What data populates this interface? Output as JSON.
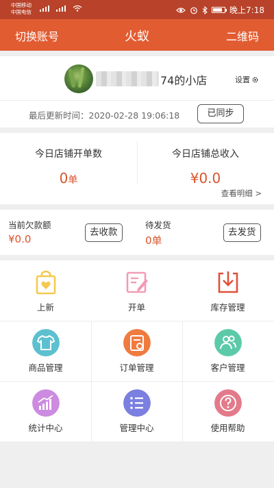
{
  "status_bar": {
    "carrier1": "中国移动",
    "carrier2": "中国电信",
    "time": "晚上7:18",
    "icons": [
      "eye-icon",
      "alarm-icon",
      "bluetooth-icon",
      "battery-icon"
    ]
  },
  "nav": {
    "left": "切换账号",
    "title": "火蚁",
    "right": "二维码"
  },
  "profile": {
    "shop_name": "74的小店",
    "settings": "设置",
    "update_time": "最后更新时间：2020-02-28 19:06:18",
    "sync_button": "已同步"
  },
  "stats": {
    "orders_label": "今日店铺开单数",
    "orders_value": "0",
    "orders_unit": "单",
    "revenue_label": "今日店铺总收入",
    "revenue_value": "¥0.0",
    "detail_link": "查看明细 >"
  },
  "debts": {
    "arrears_label": "当前欠款额",
    "arrears_value": "¥0.0",
    "collect_button": "去收款",
    "pending_label": "待发货",
    "pending_value": "0单",
    "ship_button": "去发货"
  },
  "menu": {
    "items": [
      {
        "label": "上新",
        "icon": "shopping-bag-icon",
        "color": "#f3c94e"
      },
      {
        "label": "开单",
        "icon": "edit-note-icon",
        "color": "#f29bb5"
      },
      {
        "label": "库存管理",
        "icon": "inbox-download-icon",
        "color": "#e0503a"
      },
      {
        "label": "商品管理",
        "icon": "tshirt-icon",
        "color": "#5cc0cf"
      },
      {
        "label": "订单管理",
        "icon": "order-icon",
        "color": "#ef7b3f"
      },
      {
        "label": "客户管理",
        "icon": "customers-icon",
        "color": "#5ccaa8"
      },
      {
        "label": "统计中心",
        "icon": "chart-icon",
        "color": "#cc8ae0"
      },
      {
        "label": "管理中心",
        "icon": "list-icon",
        "color": "#7b7fe0"
      },
      {
        "label": "使用帮助",
        "icon": "help-icon",
        "color": "#e37a8a"
      }
    ]
  },
  "colors": {
    "status_bar": "#b8432a",
    "nav_bar": "#e25c32",
    "accent": "#d9532b"
  }
}
